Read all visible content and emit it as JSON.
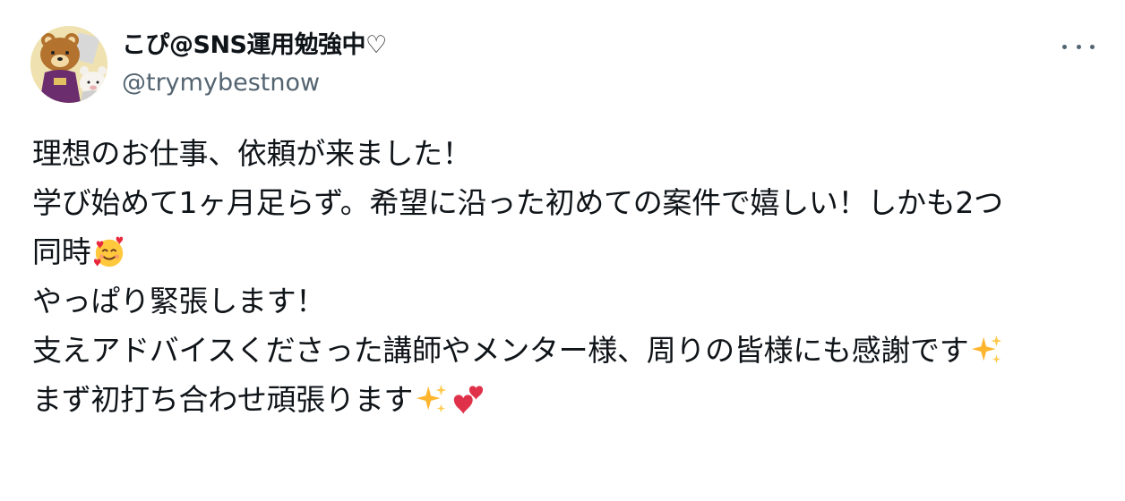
{
  "author": {
    "display_name": "こぴ@SNS運用勉強中♡",
    "handle": "@trymybestnow"
  },
  "icons": {
    "avatar": "rilakkuma-avatar",
    "more": "more-options-icon",
    "smile_hearts": "smiling-face-with-hearts-emoji",
    "sparkles": "sparkles-emoji",
    "two_hearts": "two-hearts-emoji"
  },
  "post": {
    "lines": [
      "理想のお仕事、依頼が来ました！",
      "学び始めて1ヶ月足らず。希望に沿った初めての案件で嬉しい！しかも2つ",
      "同時",
      "やっぱり緊張します！",
      "支えアドバイスくださった講師やメンター様、周りの皆様にも感謝です",
      "まず初打ち合わせ頑張ります"
    ]
  },
  "colors": {
    "text": "#0f1419",
    "secondary": "#536471"
  }
}
